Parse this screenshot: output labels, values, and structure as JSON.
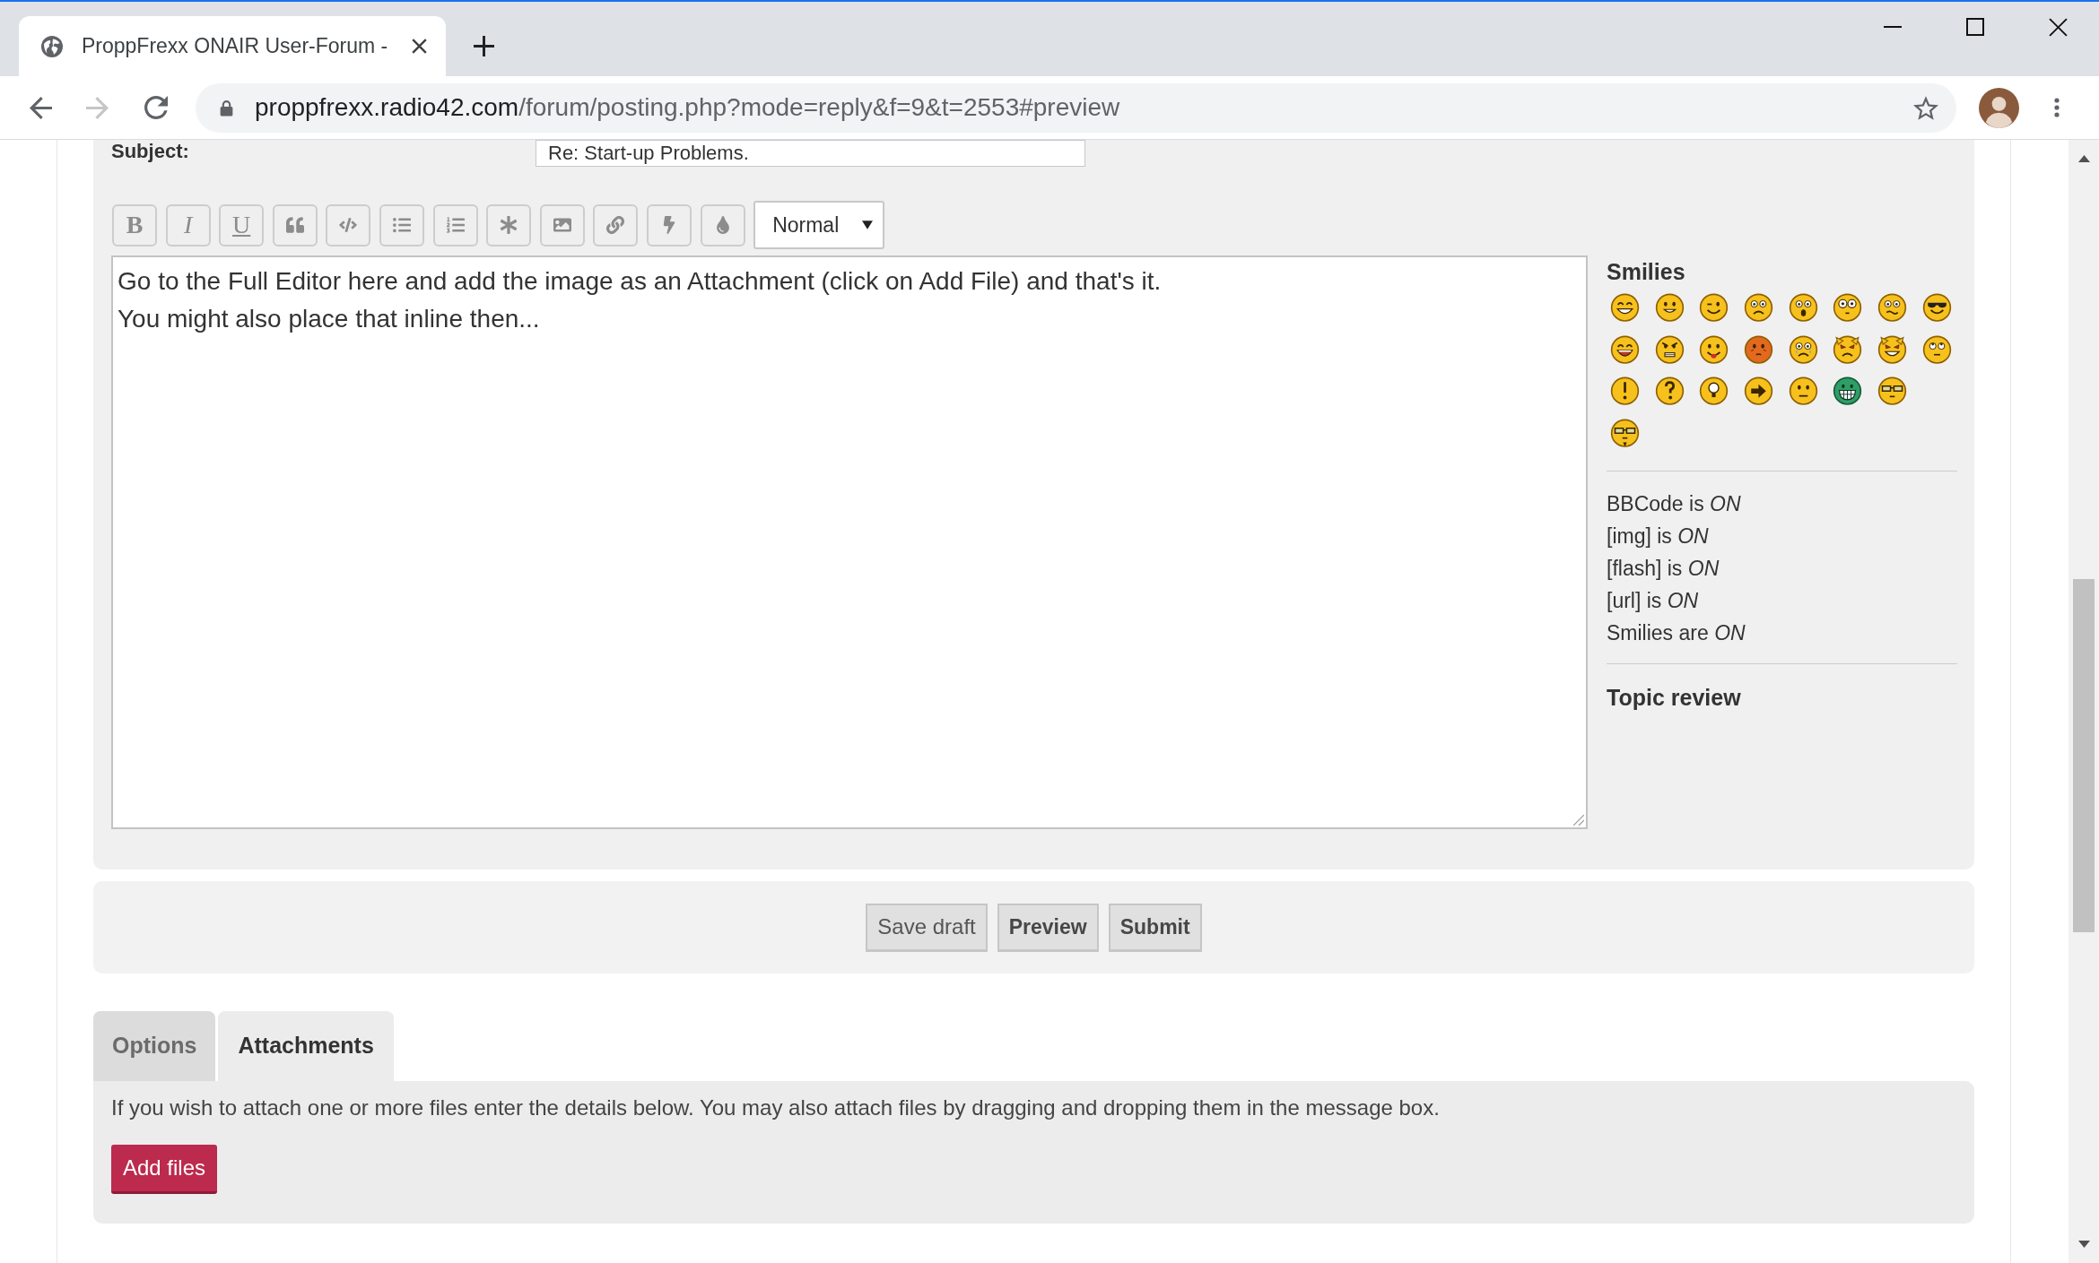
{
  "browser": {
    "tab_title": "ProppFrexx ONAIR User-Forum -",
    "nav_buttons": [
      {
        "kind": "back",
        "disabled": false
      },
      {
        "kind": "forward",
        "disabled": true
      },
      {
        "kind": "reload",
        "disabled": false
      }
    ],
    "url": {
      "host": "proppfrexx.radio42.com",
      "path": "/forum/posting.php?mode=reply&f=9&t=2553#preview"
    }
  },
  "subject": {
    "label": "Subject:",
    "value": "Re: Start-up Problems."
  },
  "toolbar": [
    {
      "kind": "bold",
      "label": "B"
    },
    {
      "kind": "italic",
      "label": "I"
    },
    {
      "kind": "underline",
      "label": "U"
    },
    {
      "kind": "quote"
    },
    {
      "kind": "code"
    },
    {
      "kind": "list"
    },
    {
      "kind": "list_numbered"
    },
    {
      "kind": "list_item"
    },
    {
      "kind": "image"
    },
    {
      "kind": "link"
    },
    {
      "kind": "flash"
    },
    {
      "kind": "color"
    }
  ],
  "font_size": {
    "value": "Normal"
  },
  "message": "Go to the Full Editor here and add the image as an Attachment (click on Add File) and that's it.\nYou might also place that inline then...",
  "sidebar": {
    "smilies_title": "Smilies",
    "options": [
      "BBCode is *ON*",
      "[img] is *ON*",
      "[flash] is *ON*",
      "[url] is *ON*",
      "Smilies are *ON*"
    ],
    "topic_review_title": "Topic review"
  },
  "actions": [
    {
      "label": "Save draft",
      "emphasized": false
    },
    {
      "label": "Preview",
      "emphasized": true
    },
    {
      "label": "Submit",
      "emphasized": true
    }
  ],
  "tabs": [
    {
      "label": "Options",
      "selected": false
    },
    {
      "label": "Attachments",
      "selected": true
    }
  ],
  "attachments": {
    "hint": "If you wish to attach one or more files enter the details below. You may also attach files by dragging and dropping them in the message box.",
    "add_button": "Add files"
  }
}
